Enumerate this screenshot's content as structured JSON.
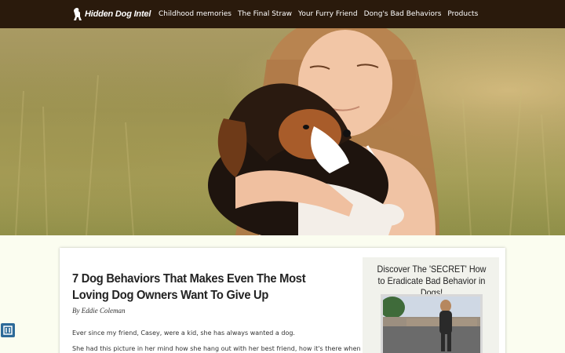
{
  "brand": {
    "name": "Hidden Dog Intel",
    "logo_icon": "dog-icon"
  },
  "nav": [
    "Childhood memories",
    "The Final Straw",
    "Your Furry Friend",
    "Dong's Bad Behaviors",
    "Products"
  ],
  "hero": {
    "description_icon": "hero-photo"
  },
  "article": {
    "title": "7 Dog Behaviors That Makes Even The Most Loving Dog Owners Want To Give Up",
    "byline": "By Eddie Coleman",
    "paragraphs": [
      "Ever since my friend, Casey, were a kid, she has always wanted a dog.",
      "She had this picture in her mind how she hang out with her best friend, how it's there when"
    ]
  },
  "sidebar": {
    "title": "Discover The 'SECRET' How to Eradicate Bad Behavior in Dogs!"
  },
  "colors": {
    "nav_bg": "#2a1a0c",
    "page_bg": "#fbfdf0",
    "badge": "#2d6a98"
  }
}
